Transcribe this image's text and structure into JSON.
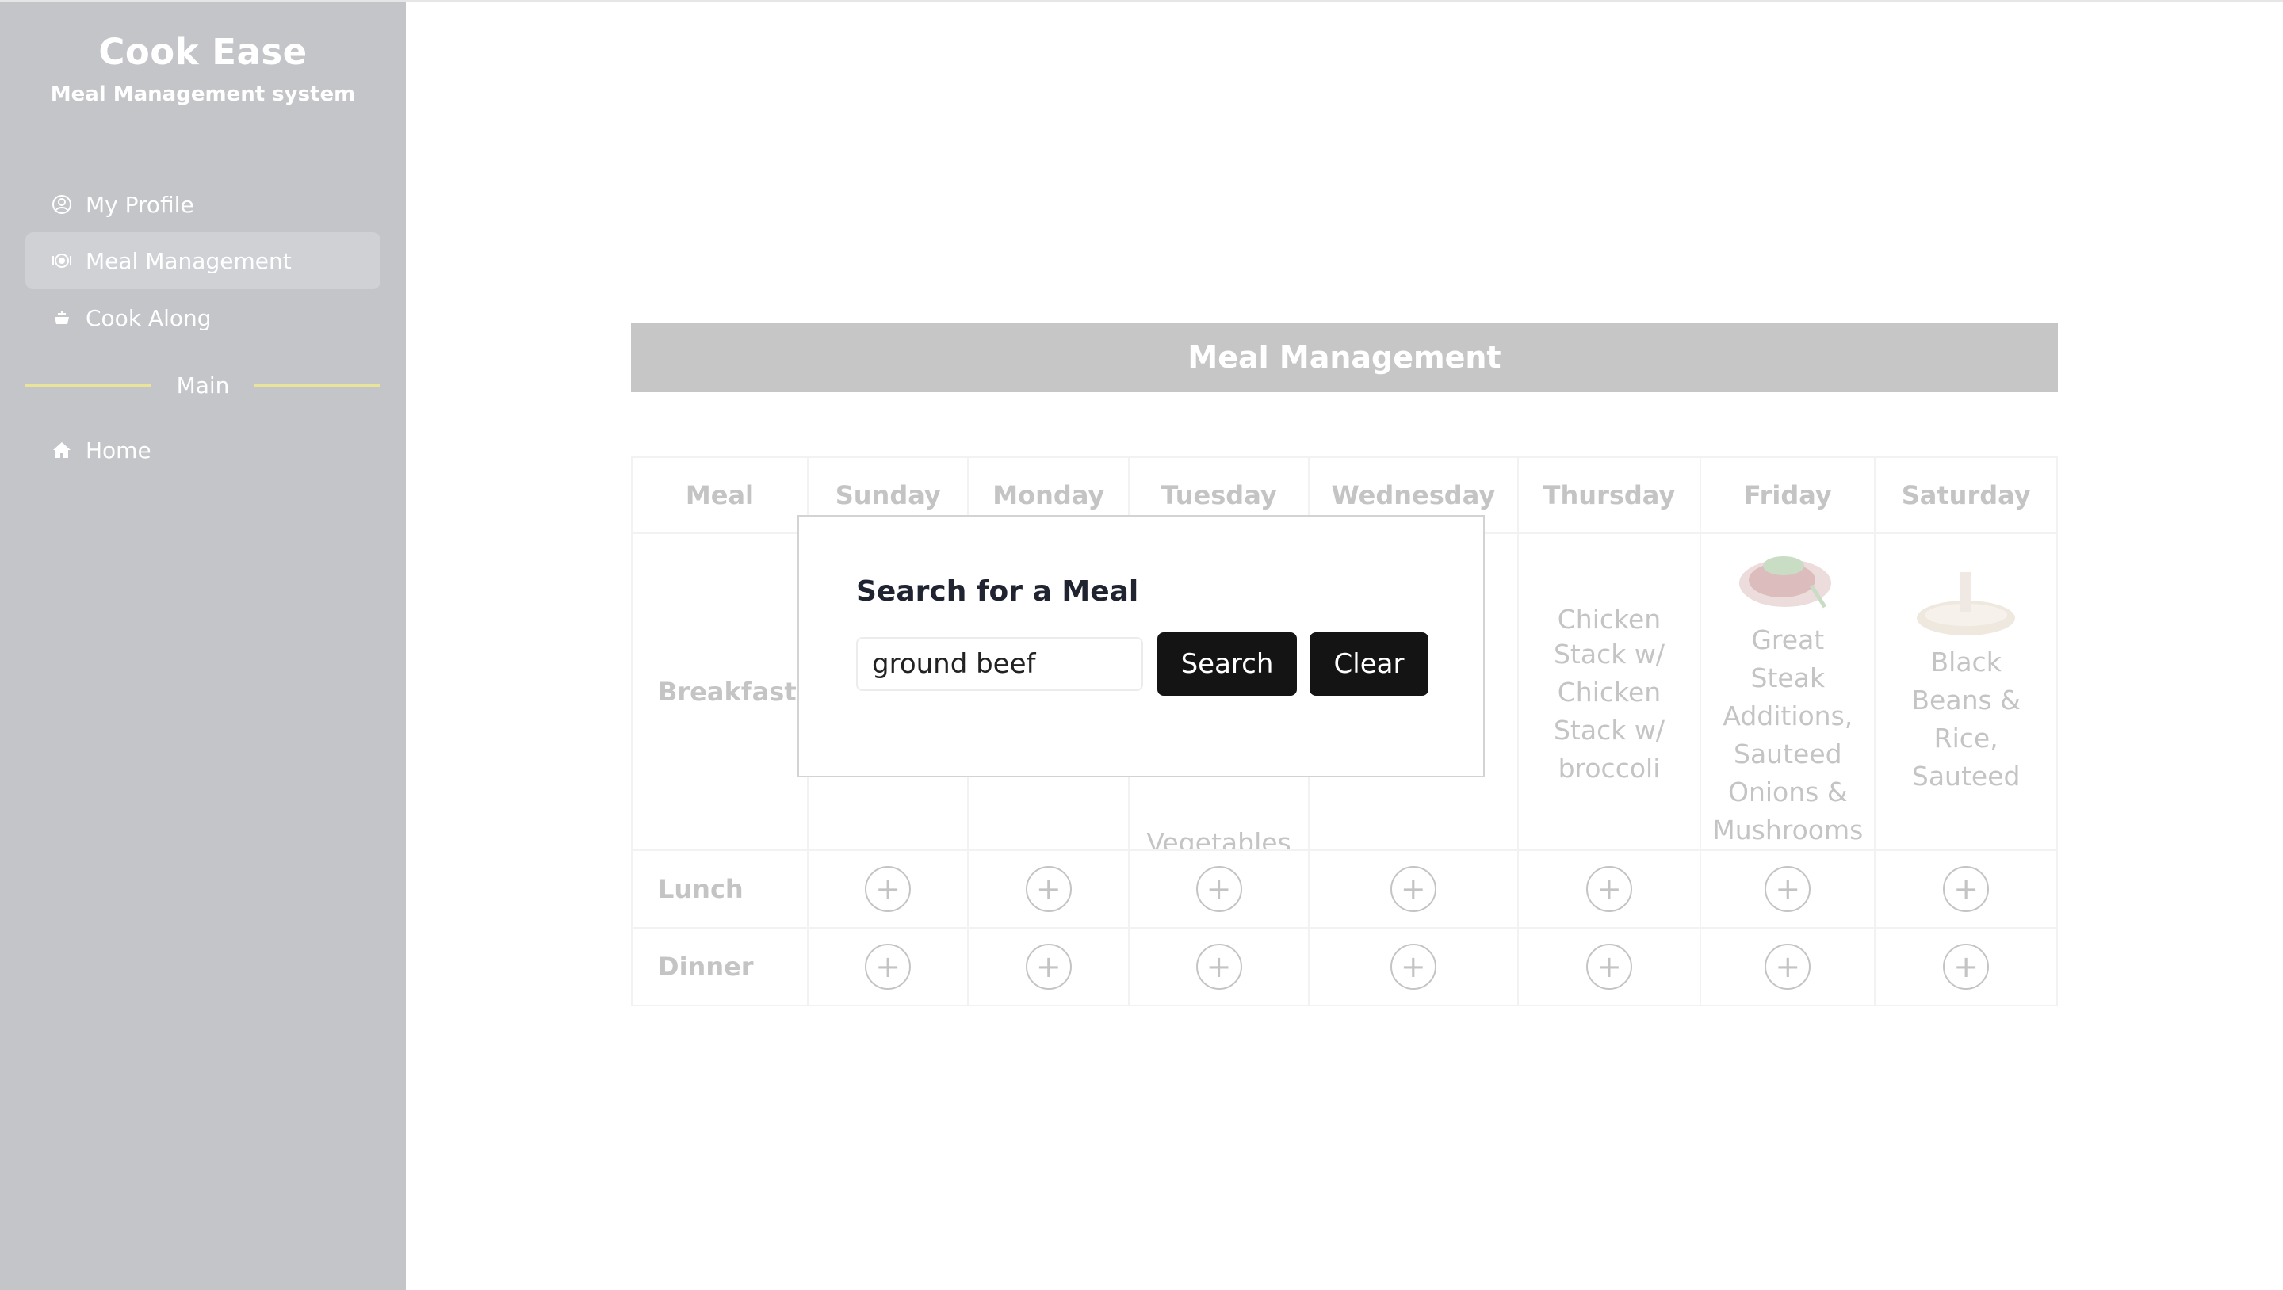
{
  "app": {
    "name": "Cook Ease",
    "subtitle": "Meal Management system"
  },
  "sidebar": {
    "items": [
      {
        "label": "My Profile",
        "icon": "user-circle-icon"
      },
      {
        "label": "Meal Management",
        "icon": "plate-icon",
        "active": true
      },
      {
        "label": "Cook Along",
        "icon": "pot-icon"
      }
    ],
    "section_label": "Main",
    "main_items": [
      {
        "label": "Home",
        "icon": "home-icon"
      }
    ],
    "accent_color": "#e8e49a"
  },
  "main": {
    "title": "Meal Management",
    "table": {
      "headers": [
        "Meal",
        "Sunday",
        "Monday",
        "Tuesday",
        "Wednesday",
        "Thursday",
        "Friday",
        "Saturday"
      ],
      "rows": [
        "Breakfast",
        "Lunch",
        "Dinner"
      ],
      "breakfast": {
        "tuesday_partial": "Vegetables",
        "thursday_alt": "Chicken Stack w/",
        "thursday": "Chicken Stack w/ broccoli",
        "friday": "Great Steak Additions, Sauteed Onions & Mushrooms",
        "saturday": "Black Beans & Rice, Sauteed"
      },
      "add_symbol": "+"
    }
  },
  "modal": {
    "title": "Search for a Meal",
    "search_value": "ground beef",
    "search_label": "Search",
    "clear_label": "Clear"
  }
}
